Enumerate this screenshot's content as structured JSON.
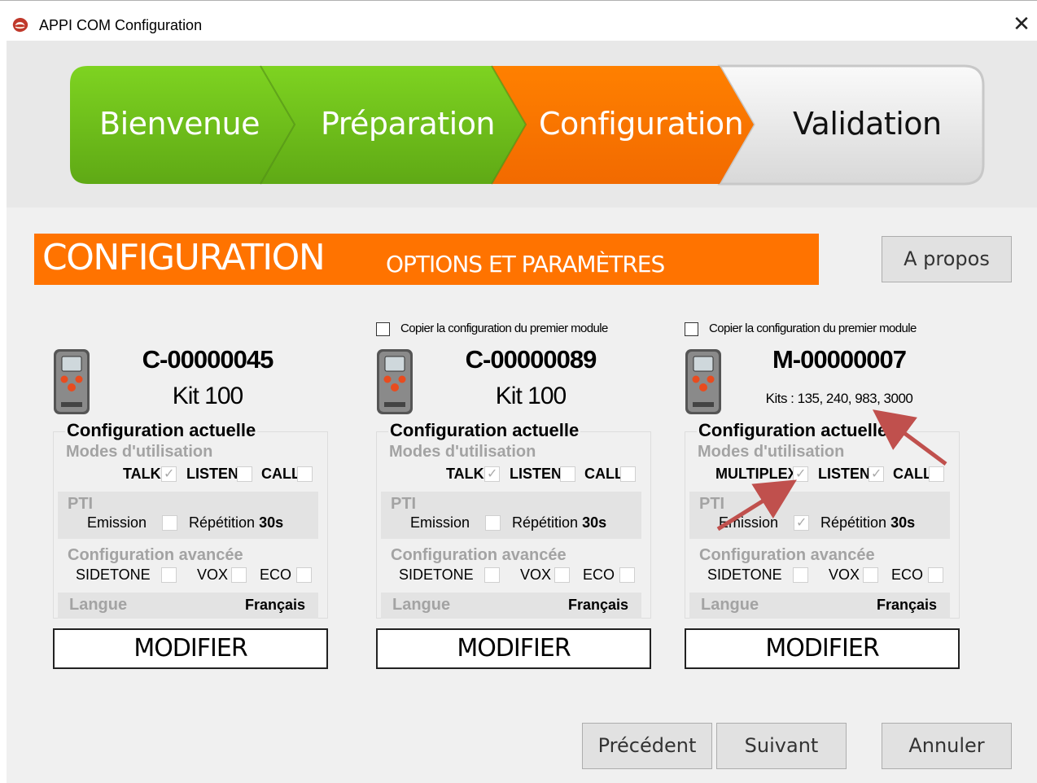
{
  "window": {
    "title": "APPI COM Configuration",
    "close_label": "✕"
  },
  "steps": [
    {
      "label": "Bienvenue",
      "state": "done",
      "color": "#6cbe1a"
    },
    {
      "label": "Préparation",
      "state": "done",
      "color": "#6cbe1a"
    },
    {
      "label": "Configuration",
      "state": "active",
      "color": "#ff7300"
    },
    {
      "label": "Validation",
      "state": "pending",
      "color": "#e8e8e8"
    }
  ],
  "banner": {
    "title": "CONFIGURATION",
    "subtitle": "OPTIONS ET PARAMÈTRES",
    "color": "#ff7300"
  },
  "about_button": "A propos",
  "modules": [
    {
      "id": "C-00000045",
      "kit": "Kit 100",
      "copy_label": "",
      "config_title": "Configuration actuelle",
      "modes_title": "Modes d'utilisation",
      "modes": [
        {
          "label": "TALK",
          "checked": true
        },
        {
          "label": "LISTEN",
          "checked": false
        },
        {
          "label": "CALL",
          "checked": false
        }
      ],
      "pti_title": "PTI",
      "emission_label": "Emission",
      "emission_checked": false,
      "repetition_label": "Répétition",
      "repetition_value": "30s",
      "advanced_title": "Configuration avancée",
      "advanced": [
        {
          "label": "SIDETONE",
          "checked": false
        },
        {
          "label": "VOX",
          "checked": false
        },
        {
          "label": "ECO",
          "checked": false
        }
      ],
      "lang_label": "Langue",
      "lang_value": "Français",
      "modify_label": "MODIFIER"
    },
    {
      "id": "C-00000089",
      "kit": "Kit 100",
      "copy_label": "Copier la configuration du premier module",
      "config_title": "Configuration actuelle",
      "modes_title": "Modes d'utilisation",
      "modes": [
        {
          "label": "TALK",
          "checked": true
        },
        {
          "label": "LISTEN",
          "checked": false
        },
        {
          "label": "CALL",
          "checked": false
        }
      ],
      "pti_title": "PTI",
      "emission_label": "Emission",
      "emission_checked": false,
      "repetition_label": "Répétition",
      "repetition_value": "30s",
      "advanced_title": "Configuration avancée",
      "advanced": [
        {
          "label": "SIDETONE",
          "checked": false
        },
        {
          "label": "VOX",
          "checked": false
        },
        {
          "label": "ECO",
          "checked": false
        }
      ],
      "lang_label": "Langue",
      "lang_value": "Français",
      "modify_label": "MODIFIER"
    },
    {
      "id": "M-00000007",
      "kit": "Kits : 135, 240, 983, 3000",
      "copy_label": "Copier la configuration du premier module",
      "config_title": "Configuration actuelle",
      "modes_title": "Modes d'utilisation",
      "modes": [
        {
          "label": "MULTIPLEX",
          "checked": true
        },
        {
          "label": "LISTEN",
          "checked": true
        },
        {
          "label": "CALL",
          "checked": false
        }
      ],
      "pti_title": "PTI",
      "emission_label": "Emission",
      "emission_checked": true,
      "repetition_label": "Répétition",
      "repetition_value": "30s",
      "advanced_title": "Configuration avancée",
      "advanced": [
        {
          "label": "SIDETONE",
          "checked": false
        },
        {
          "label": "VOX",
          "checked": false
        },
        {
          "label": "ECO",
          "checked": false
        }
      ],
      "lang_label": "Langue",
      "lang_value": "Français",
      "modify_label": "MODIFIER"
    }
  ],
  "footer": {
    "previous": "Précédent",
    "next": "Suivant",
    "cancel": "Annuler"
  },
  "colors": {
    "green": "#6cbe1a",
    "orange": "#ff7300",
    "annotation_arrow": "#c0504d"
  }
}
